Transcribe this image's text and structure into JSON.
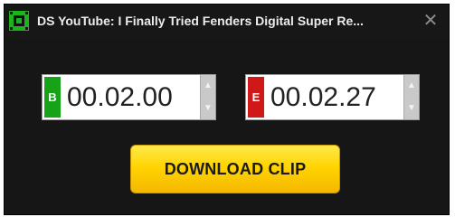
{
  "window": {
    "title": "DS YouTube: I Finally Tried Fenders Digital Super Re...",
    "close_label": "✕"
  },
  "app_icon": {
    "name": "app-logo-icon",
    "color": "#1db31d"
  },
  "clip": {
    "start": {
      "badge": "B",
      "badge_color": "#17a317",
      "time": "00.02.00"
    },
    "end": {
      "badge": "E",
      "badge_color": "#d11818",
      "time": "00.02.27"
    },
    "spinner": {
      "up": "▲",
      "down": "▼"
    }
  },
  "download_button": {
    "label": "DOWNLOAD CLIP",
    "color": "#ffd400"
  }
}
